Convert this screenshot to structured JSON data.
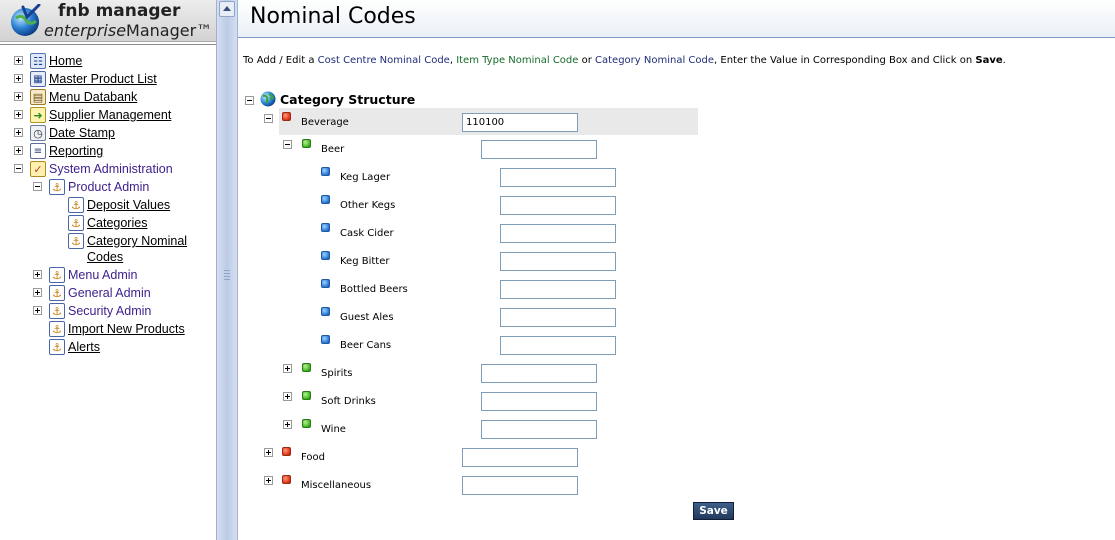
{
  "brand": {
    "title": "fnb manager",
    "subtitle_italic": "enterprise",
    "subtitle_rest": "Manager™"
  },
  "sidebar": {
    "items": [
      {
        "label": "Home"
      },
      {
        "label": "Master Product List"
      },
      {
        "label": "Menu Databank"
      },
      {
        "label": "Supplier Management"
      },
      {
        "label": "Date Stamp"
      },
      {
        "label": "Reporting"
      },
      {
        "label": "System Administration"
      },
      {
        "label": "Product Admin"
      },
      {
        "label": "Deposit Values"
      },
      {
        "label": "Categories"
      },
      {
        "label": "Category Nominal"
      },
      {
        "label": "Codes"
      },
      {
        "label": "Menu Admin"
      },
      {
        "label": "General Admin"
      },
      {
        "label": "Security Admin"
      },
      {
        "label": "Import New Products"
      },
      {
        "label": "Alerts"
      }
    ]
  },
  "main": {
    "title": "Nominal Codes",
    "instruction": {
      "p1": "To Add / Edit  a ",
      "p2": "Cost Centre Nominal Code",
      "p3": ", ",
      "p4": "Item Type Nominal Code",
      "p5": " or ",
      "p6": "Category Nominal Code",
      "p7": ",  Enter the Value in Corresponding Box and Click on ",
      "p8": "Save",
      "p9": "."
    },
    "category_structure": "Category Structure",
    "tree": {
      "beverage": {
        "label": "Beverage",
        "value": "110100"
      },
      "beer": {
        "label": "Beer",
        "value": ""
      },
      "keg_lager": {
        "label": "Keg Lager",
        "value": ""
      },
      "other_kegs": {
        "label": "Other Kegs",
        "value": ""
      },
      "cask_cider": {
        "label": "Cask Cider",
        "value": ""
      },
      "keg_bitter": {
        "label": "Keg Bitter",
        "value": ""
      },
      "bottled_beers": {
        "label": "Bottled Beers",
        "value": ""
      },
      "guest_ales": {
        "label": "Guest Ales",
        "value": ""
      },
      "beer_cans": {
        "label": "Beer Cans",
        "value": ""
      },
      "spirits": {
        "label": "Spirits",
        "value": ""
      },
      "soft_drinks": {
        "label": "Soft Drinks",
        "value": ""
      },
      "wine": {
        "label": "Wine",
        "value": ""
      },
      "food": {
        "label": "Food",
        "value": ""
      },
      "miscellaneous": {
        "label": "Miscellaneous",
        "value": ""
      }
    },
    "save_label": "Save"
  },
  "colors": {
    "accent_navy": "#1f2e7a",
    "accent_green": "#186b2b",
    "save_button": "#2d4670"
  }
}
